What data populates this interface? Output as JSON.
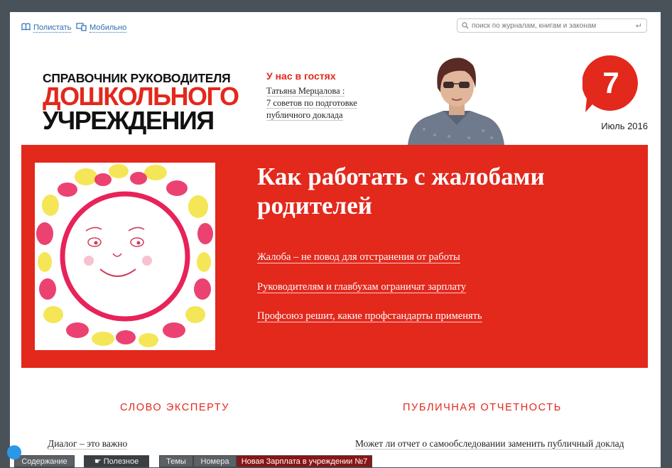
{
  "toolbar": {
    "flip_label": "Полистать",
    "mobile_label": "Мобильно",
    "search_placeholder": "поиск по журналам, книгам и законам"
  },
  "masthead": {
    "logo_line1": "СПРАВОЧНИК РУКОВОДИТЕЛЯ",
    "logo_line2": "ДОШКОЛЬНОГО",
    "logo_line3": "УЧРЕЖДЕНИЯ",
    "issue_number": "7",
    "issue_date": "Июль 2016"
  },
  "guest": {
    "title": "У нас в гостях",
    "line1": "Татьяна Мерцалова :",
    "line2": "7 советов по подготовке",
    "line3": "публичного доклада"
  },
  "hero": {
    "title": "Как работать с жалобами родителей",
    "links": [
      "Жалоба – не повод для отстранения от работы",
      "Руководителям и главбухам ограничат зарплату",
      "Профсоюз решит, какие профстандарты применять"
    ]
  },
  "sections": {
    "left_title": "СЛОВО ЭКСПЕРТУ",
    "left_article": "Диалог – это важно",
    "right_title": "ПУБЛИЧНАЯ ОТЧЕТНОСТЬ",
    "right_article": "Может ли отчет о самообследовании заменить публичный доклад"
  },
  "bottom_tabs": {
    "contents": "Содержание",
    "useful": "Полезное",
    "themes": "Темы",
    "issues": "Номера",
    "promo": "Новая Зарплата в учреждении №7"
  },
  "colors": {
    "brand_red": "#e3281c",
    "bottom_tab": "#5c6166",
    "promo_tab": "#8a1515"
  }
}
